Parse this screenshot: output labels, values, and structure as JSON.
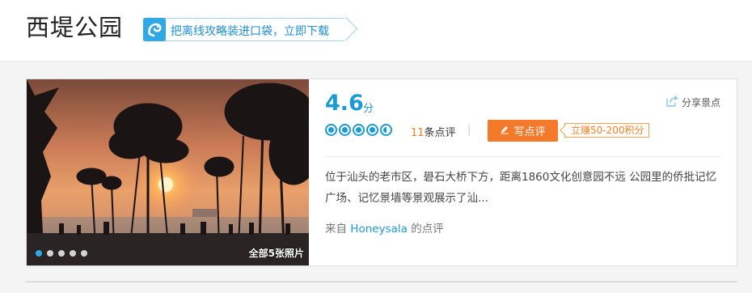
{
  "header": {
    "title": "西堤公园",
    "promo_text": "把离线攻略装进口袋，立即下载"
  },
  "photo": {
    "all_photos_label": "全部5张照片",
    "dot_count": 5,
    "active_dot": 0
  },
  "rating": {
    "score": "4.6",
    "score_unit": "分",
    "review_count": "11",
    "review_suffix": "条点评",
    "separator": "|",
    "rating_fraction": 0.92
  },
  "actions": {
    "share_label": "分享景点",
    "write_review_label": "写点评",
    "earn_points_label": "立赚50-200积分"
  },
  "review": {
    "text": "位于汕头的老市区，礐石大桥下方，距离1860文化创意园不远 公园里的侨批记忆广场、记忆景墙等景观展示了汕...",
    "source_prefix": "来自",
    "source_user": "Honeysala",
    "source_suffix": "的点评"
  },
  "colors": {
    "accent_blue": "#1a9ad6",
    "accent_orange": "#f47a2b"
  }
}
